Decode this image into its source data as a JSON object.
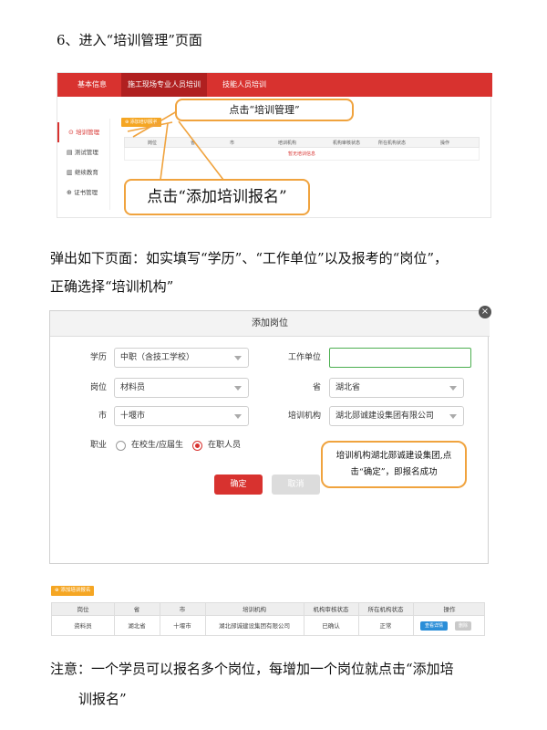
{
  "heading": "6、进入“培训管理”页面",
  "shot1": {
    "nav": [
      "基本信息",
      "施工现场专业人员培训",
      "技能人员培训"
    ],
    "side": [
      "培训管理",
      "测试管理",
      "继续教育",
      "证书管理"
    ],
    "add_button": "添加培训报名",
    "columns": [
      "岗位",
      "省",
      "市",
      "培训机构",
      "机构审核状态",
      "所在机构状态",
      "操作"
    ],
    "empty_text": "暂无培训信息",
    "callout_top": "点击“培训管理”",
    "callout_bottom": "点击“添加培训报名”"
  },
  "para1_line1": "弹出如下页面：如实填写“学历”、“工作单位”以及报考的“岗位”，",
  "para1_line2": "正确选择“培训机构”",
  "dialog": {
    "title": "添加岗位",
    "close": "×",
    "edu_label": "学历",
    "edu_value": "中职（含技工学校）",
    "work_label": "工作单位",
    "work_value": "",
    "post_label": "岗位",
    "post_value": "材料员",
    "province_label": "省",
    "province_value": "湖北省",
    "city_label": "市",
    "city_value": "十堰市",
    "org_label": "培训机构",
    "org_value": "湖北郧诚建设集团有限公司",
    "job_label": "职业",
    "job_options": [
      "在校生/应届生",
      "在职人员"
    ],
    "job_selected": "在职人员",
    "ok": "确定",
    "cancel": "取消",
    "callout": "培训机构湖北郧诚建设集团,点击“确定”，即报名成功"
  },
  "shot3": {
    "add_button": "添加培训报名",
    "columns": [
      "岗位",
      "省",
      "市",
      "培训机构",
      "机构审核状态",
      "所在机构状态",
      "操作"
    ],
    "row": [
      "资料员",
      "湖北省",
      "十堰市",
      "湖北郧诚建设集团有限公司",
      "已确认",
      "正常"
    ],
    "view_button": "查看详情",
    "delete_button": "删除"
  },
  "note_line1": "注意：一个学员可以报名多个岗位，每增加一个岗位就点击“添加培",
  "note_line2": "训报名”",
  "colors": {
    "brand_red": "#d8322f",
    "callout_orange": "#f0a33e",
    "primary_blue": "#2b8ed8"
  }
}
